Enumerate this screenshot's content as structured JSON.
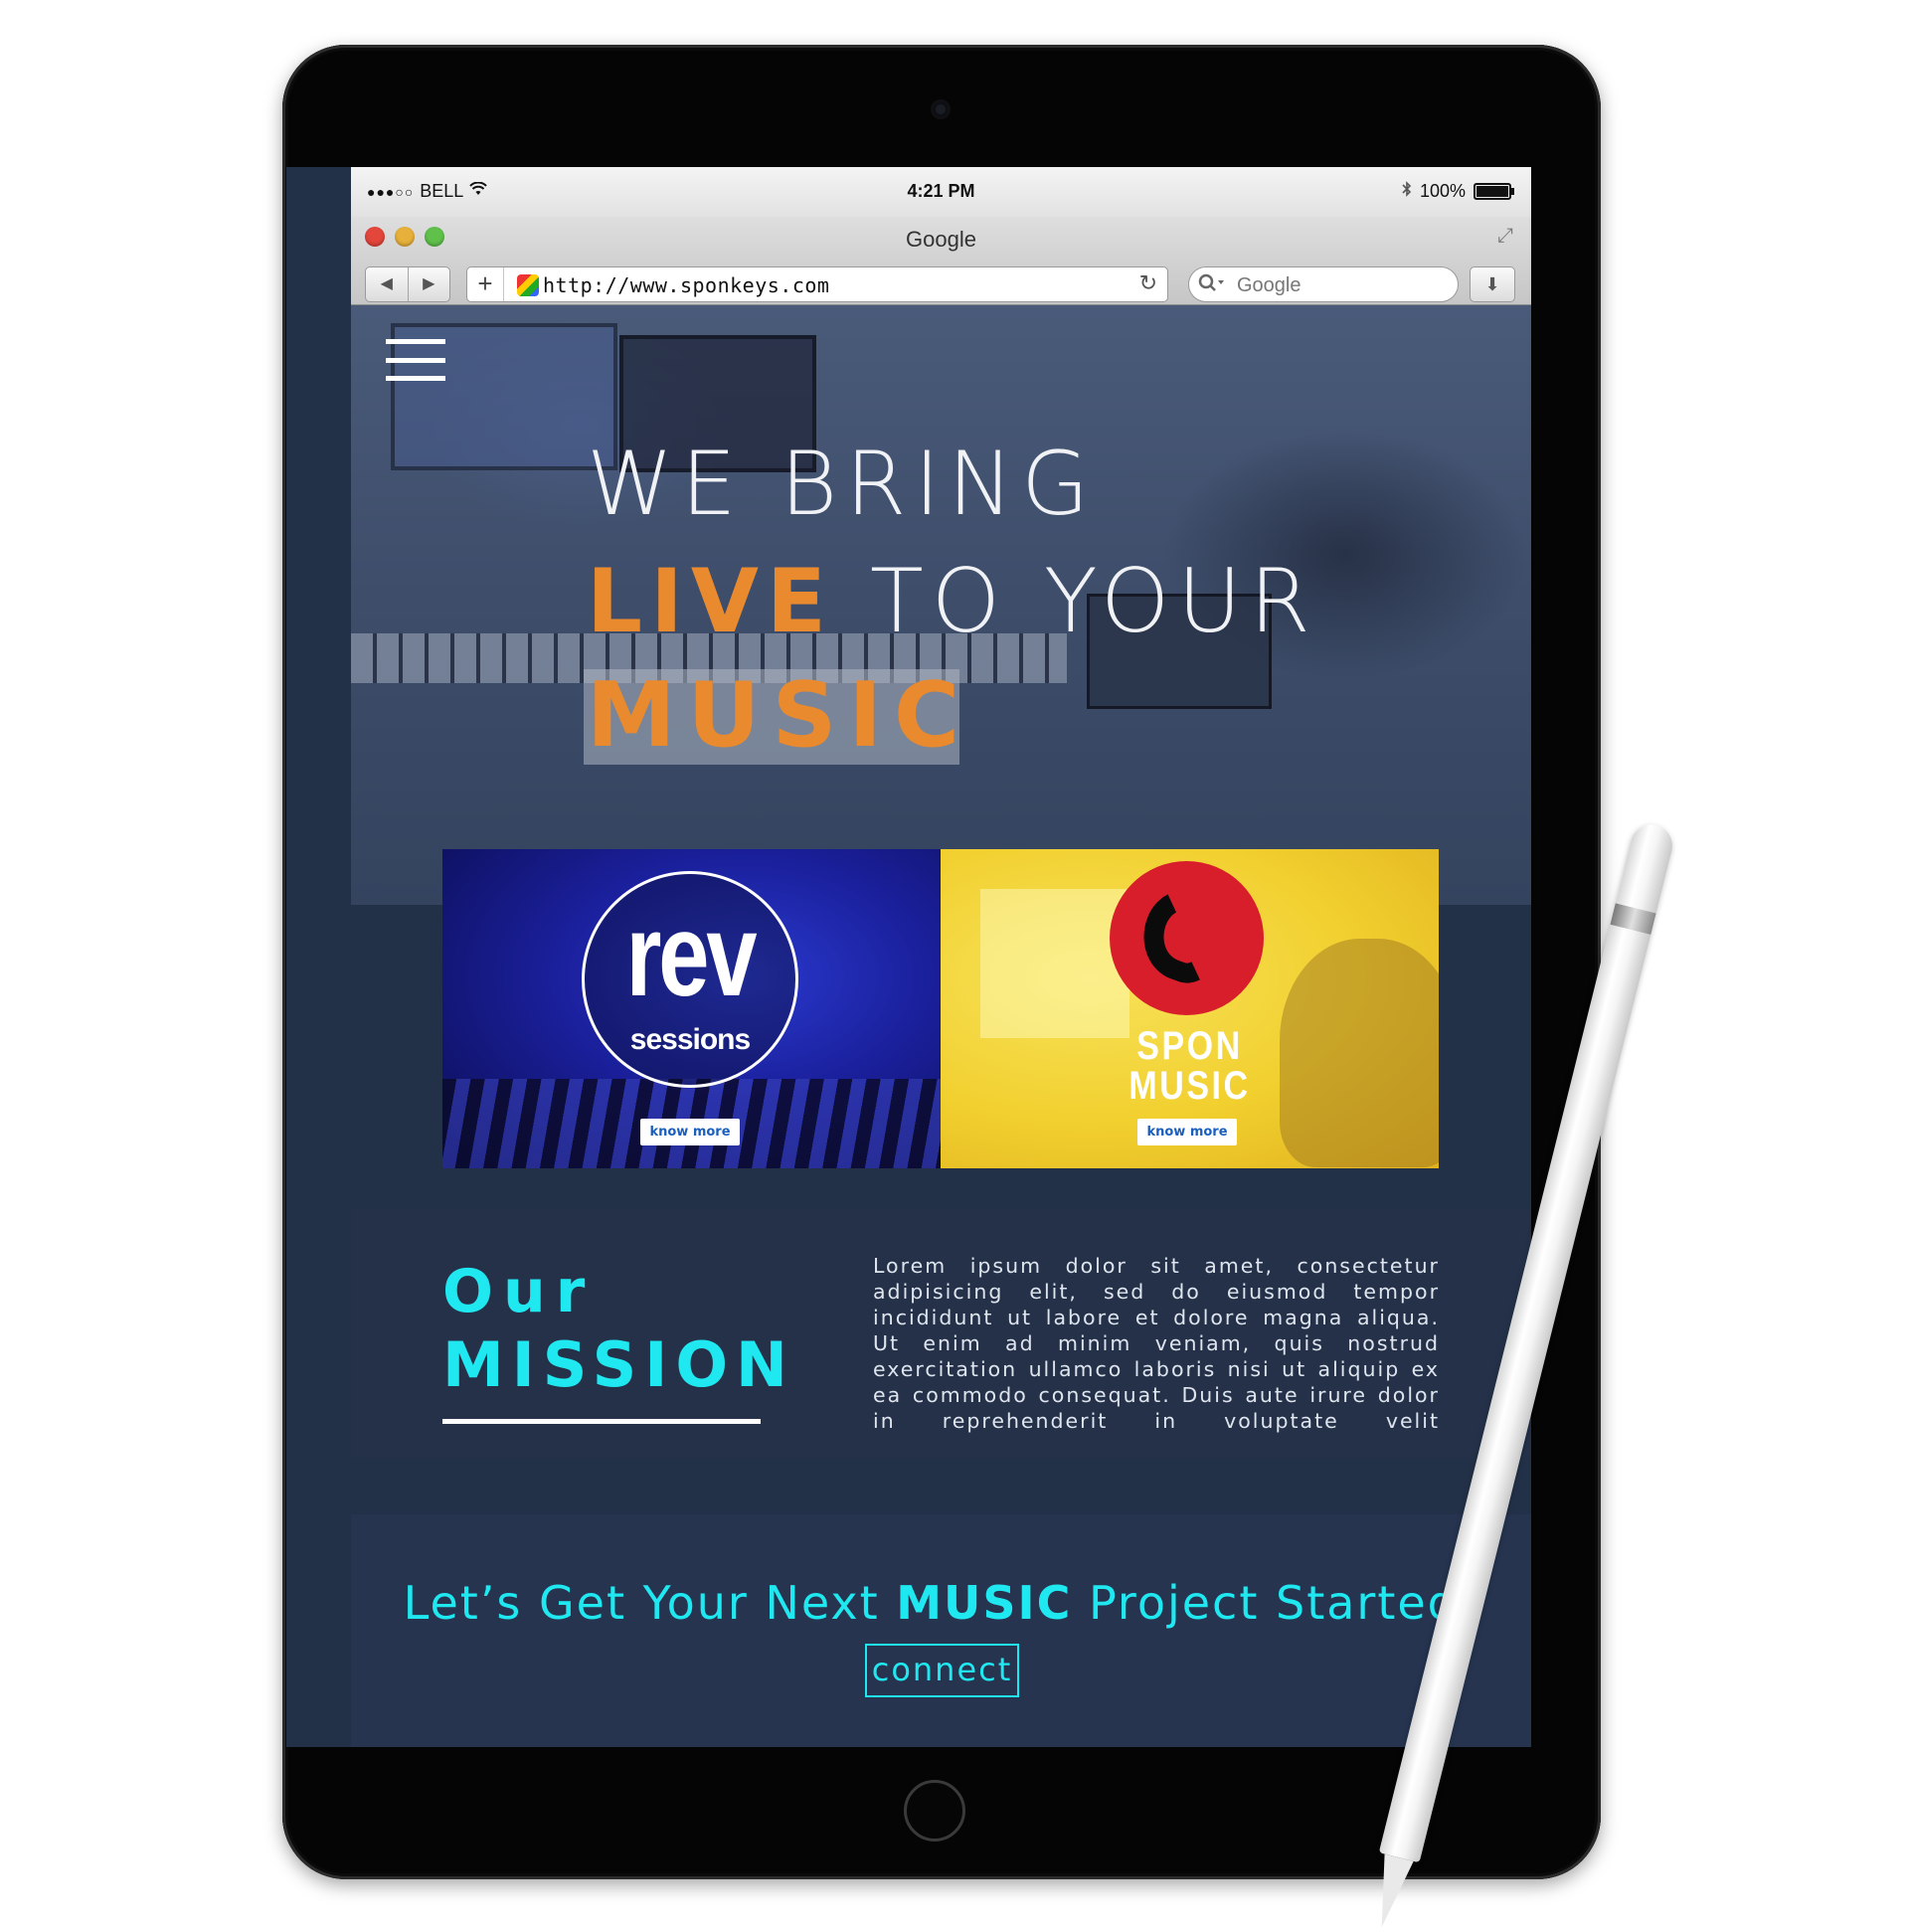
{
  "status_bar": {
    "carrier": "BELL",
    "signal": "●●●○○",
    "time": "4:21 PM",
    "battery_text": "100%",
    "battery_level": 1.0,
    "bluetooth_icon": "bluetooth-icon",
    "wifi_icon": "wifi-icon"
  },
  "browser": {
    "window_title": "Google",
    "url": "http://www.sponkeys.com",
    "search_placeholder": "Google",
    "back_glyph": "◀",
    "forward_glyph": "▶",
    "new_tab_glyph": "+",
    "reload_glyph": "↻",
    "download_glyph": "⬇",
    "traffic_lights": [
      "#e3463b",
      "#e6b03a",
      "#5fc04a"
    ]
  },
  "hero": {
    "line1": "WE BRING",
    "line2_highlight": "LIVE",
    "line2_rest": " TO YOUR",
    "line3": "MUSIC",
    "accent_color": "#e98a2e"
  },
  "cards": [
    {
      "logo_main": "rev",
      "logo_sub": "sessions",
      "button_label": "know more"
    },
    {
      "logo_line1": "SPON",
      "logo_line2": "MUSIC",
      "button_label": "know more"
    }
  ],
  "mission": {
    "title_small": "Our",
    "title_big": "MISSION",
    "body": "Lorem ipsum dolor sit amet, consectetur adipisicing elit, sed do eiusmod tempor incididunt ut labore et dolore magna aliqua. Ut enim ad minim veniam, quis nostrud exercitation ullamco laboris nisi ut aliquip ex ea commodo consequat. Duis aute irure dolor in reprehenderit in voluptate velit",
    "accent_color": "#1fe8f0"
  },
  "cta": {
    "headline_pre": "Let’s Get Your Next ",
    "headline_bold": "MUSIC",
    "headline_post": " Project Started!",
    "button_label": "connect"
  }
}
